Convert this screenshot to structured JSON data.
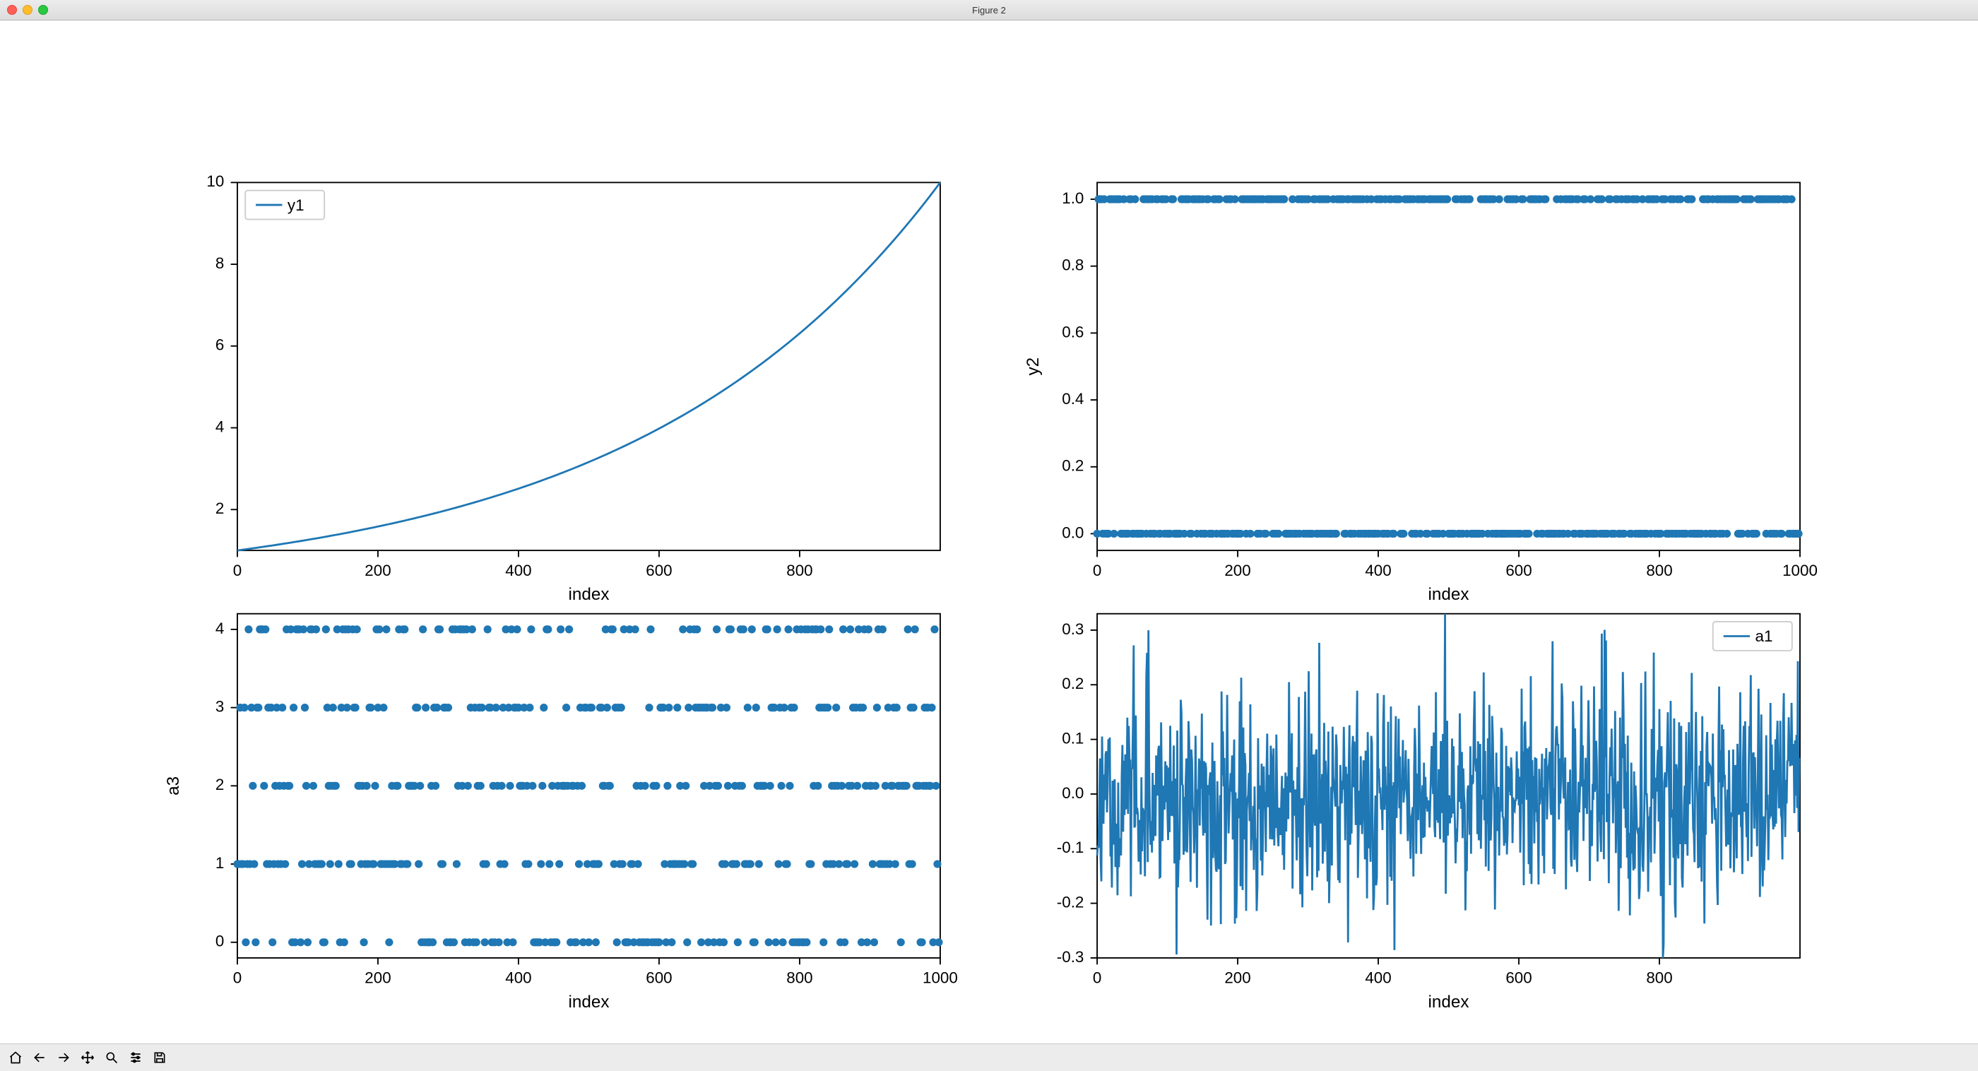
{
  "window": {
    "title": "Figure 2"
  },
  "chart_color": "#1f77b4",
  "chart_data": [
    {
      "type": "line",
      "series": [
        {
          "name": "y1",
          "generator": "exp",
          "y0": 1,
          "y1": 10
        }
      ],
      "xlabel": "index",
      "ylabel": "",
      "xlim": [
        0,
        1000
      ],
      "ylim": [
        1,
        10
      ],
      "xticks": [
        0,
        200,
        400,
        600,
        800
      ],
      "yticks": [
        2,
        4,
        6,
        8,
        10
      ],
      "legend": {
        "position": "upper-left",
        "entries": [
          "y1"
        ]
      }
    },
    {
      "type": "scatter",
      "ylabel": "y2",
      "xlabel": "index",
      "xlim": [
        0,
        1000
      ],
      "ylim": [
        -0.05,
        1.05
      ],
      "xticks": [
        0,
        200,
        400,
        600,
        800,
        1000
      ],
      "yticks": [
        0.0,
        0.2,
        0.4,
        0.6,
        0.8,
        1.0
      ],
      "series": [
        {
          "name": "y2",
          "generator": "binary01",
          "n": 1000
        }
      ]
    },
    {
      "type": "scatter",
      "ylabel": "a3",
      "xlabel": "index",
      "xlim": [
        0,
        1000
      ],
      "ylim": [
        -0.2,
        4.2
      ],
      "xticks": [
        0,
        200,
        400,
        600,
        800,
        1000
      ],
      "yticks": [
        0,
        1,
        2,
        3,
        4
      ],
      "series": [
        {
          "name": "a3",
          "generator": "discrete05",
          "n": 1000
        }
      ]
    },
    {
      "type": "line",
      "ylabel": "",
      "xlabel": "index",
      "xlim": [
        0,
        1000
      ],
      "ylim": [
        -0.3,
        0.33
      ],
      "xticks": [
        0,
        200,
        400,
        600,
        800
      ],
      "yticks": [
        -0.3,
        -0.2,
        -0.1,
        0.0,
        0.1,
        0.2,
        0.3
      ],
      "series": [
        {
          "name": "a1",
          "generator": "noise",
          "sigma": 0.1,
          "n": 1000
        }
      ],
      "legend": {
        "position": "upper-right",
        "entries": [
          "a1"
        ]
      }
    }
  ],
  "toolbar": {
    "buttons": [
      "home",
      "back",
      "forward",
      "pan",
      "zoom",
      "subplots",
      "save"
    ]
  }
}
